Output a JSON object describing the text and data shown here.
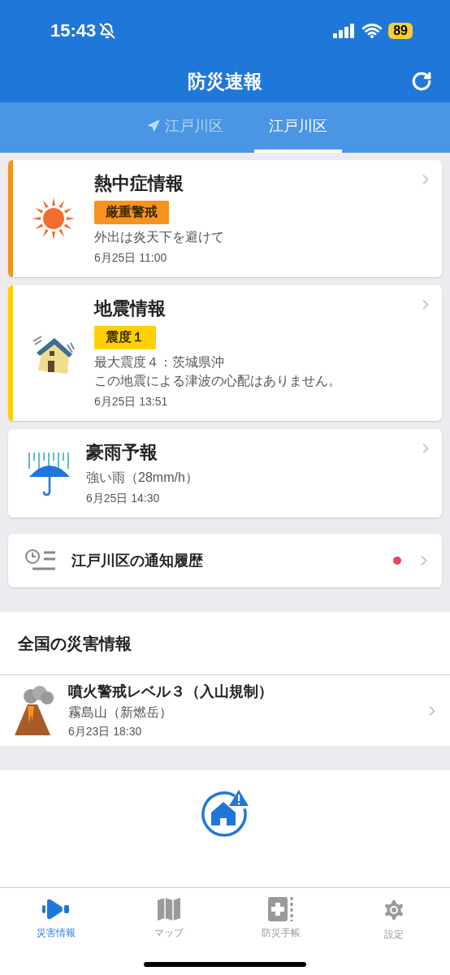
{
  "status_bar": {
    "time": "15:43",
    "battery": "89"
  },
  "header": {
    "title": "防災速報"
  },
  "tabs": [
    {
      "label": "江戸川区",
      "kind": "current_location",
      "selected": false
    },
    {
      "label": "江戸川区",
      "kind": "registered",
      "selected": true
    }
  ],
  "alerts": [
    {
      "kind": "heat",
      "title": "熱中症情報",
      "color": "#f7931e",
      "badge": "厳重警戒",
      "lines": [
        "外出は炎天下を避けて"
      ],
      "time": "6月25日 11:00"
    },
    {
      "kind": "earthquake",
      "title": "地震情報",
      "color": "#ffd000",
      "badge": "震度１",
      "lines": [
        "最大震度４：茨城県沖",
        "この地震による津波の心配はありません。"
      ],
      "time": "6月25日 13:51"
    },
    {
      "kind": "rain",
      "title": "豪雨予報",
      "lines": [
        "強い雨（28mm/h）"
      ],
      "time": "6月25日 14:30"
    }
  ],
  "history": {
    "label": "江戸川区の通知履歴",
    "unread": true
  },
  "national": {
    "heading": "全国の災害情報",
    "items": [
      {
        "kind": "volcano",
        "title": "噴火警戒レベル３（入山規制）",
        "subtitle": "霧島山（新燃岳）",
        "time": "6月23日 18:30"
      }
    ]
  },
  "nav": [
    {
      "label": "災害情報",
      "kind": "alerts",
      "selected": true
    },
    {
      "label": "マップ",
      "kind": "map",
      "selected": false
    },
    {
      "label": "防災手帳",
      "kind": "handbook",
      "selected": false
    },
    {
      "label": "設定",
      "kind": "settings",
      "selected": false
    }
  ]
}
